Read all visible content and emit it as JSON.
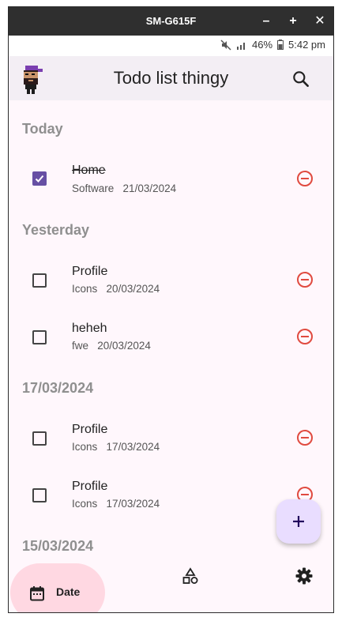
{
  "window": {
    "title": "SM-G615F",
    "minimize_label": "–",
    "maximize_label": "+",
    "close_label": "✕"
  },
  "status": {
    "battery": "46%",
    "time": "5:42 pm"
  },
  "appbar": {
    "title": "Todo list thingy",
    "search_icon": "search-icon"
  },
  "sections": [
    {
      "header": "Today",
      "items": [
        {
          "title": "Home",
          "tag": "Software",
          "date": "21/03/2024",
          "done": true
        }
      ]
    },
    {
      "header": "Yesterday",
      "items": [
        {
          "title": "Profile",
          "tag": "Icons",
          "date": "20/03/2024",
          "done": false
        },
        {
          "title": "heheh",
          "tag": "fwe",
          "date": "20/03/2024",
          "done": false
        }
      ]
    },
    {
      "header": "17/03/2024",
      "items": [
        {
          "title": "Profile",
          "tag": "Icons",
          "date": "17/03/2024",
          "done": false
        },
        {
          "title": "Profile",
          "tag": "Icons",
          "date": "17/03/2024",
          "done": false
        }
      ]
    },
    {
      "header": "15/03/2024",
      "items": []
    }
  ],
  "fab": {
    "label": "+"
  },
  "bottom_nav": {
    "date_label": "Date",
    "shapes_icon": "shapes-icon",
    "settings_icon": "gear-icon"
  },
  "colors": {
    "accent": "#6750a4",
    "remove": "#e04a3f",
    "fab": "#e9ddff",
    "nav_active": "#ffd8e2"
  }
}
